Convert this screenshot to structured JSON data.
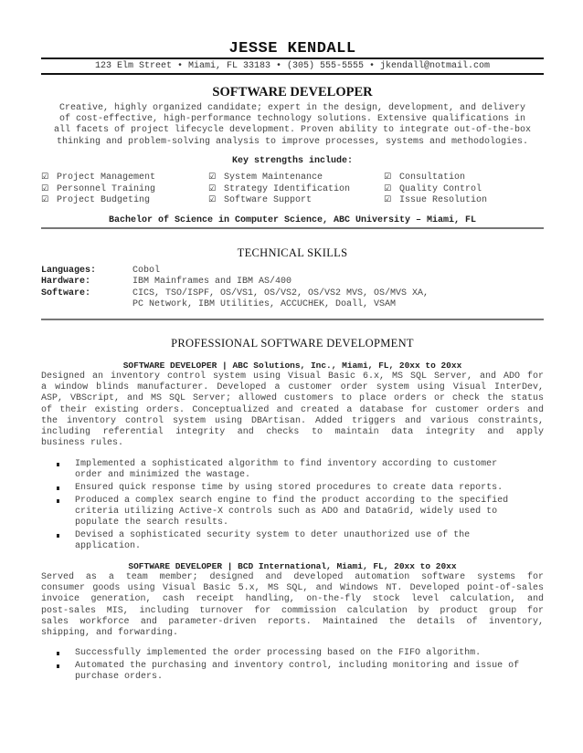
{
  "header": {
    "name": "JESSE KENDALL",
    "contact": "123 Elm Street • Miami, FL 33183 • (305) 555-5555 • jkendall@notmail.com"
  },
  "profile": {
    "title": "SOFTWARE DEVELOPER",
    "summary_lines": [
      "Creative, highly organized candidate; expert in the design, development, and delivery",
      "of cost-effective, high-performance technology solutions. Extensive qualifications in",
      "all facets of project lifecycle development. Proven ability to integrate out-of-the-box",
      "thinking and problem-solving analysis to improve processes, systems and methodologies."
    ]
  },
  "key_strengths": {
    "heading": "Key strengths include:",
    "checkbox_icon": "☑",
    "columns": [
      [
        "Project Management",
        "Personnel Training",
        "Project Budgeting"
      ],
      [
        "System Maintenance",
        "Strategy Identification",
        "Software Support"
      ],
      [
        "Consultation",
        "Quality Control",
        "Issue Resolution"
      ]
    ]
  },
  "education": "Bachelor of Science in Computer Science, ABC University – Miami, FL",
  "technical_skills": {
    "heading": "TECHNICAL SKILLS",
    "rows": [
      {
        "label": "Languages:",
        "lines": [
          "Cobol"
        ]
      },
      {
        "label": "Hardware:",
        "lines": [
          "IBM Mainframes and IBM AS/400"
        ]
      },
      {
        "label": "Software:",
        "lines": [
          "CICS, TSO/ISPF, OS/VS1, OS/VS2, OS/VS2 MVS, OS/MVS XA,",
          "PC Network, IBM Utilities, ACCUCHEK, Doall, VSAM"
        ]
      }
    ]
  },
  "experience": {
    "heading": "PROFESSIONAL SOFTWARE DEVELOPMENT",
    "jobs": [
      {
        "title": "SOFTWARE DEVELOPER | ABC Solutions, Inc., Miami, FL, 20xx to 20xx",
        "description_lines": [
          "Designed an inventory control system using Visual Basic 6.x, MS SQL Server, and ADO for",
          "a window blinds manufacturer. Developed a customer order system using Visual InterDev,",
          "ASP, VBScript, and MS SQL Server; allowed customers to place orders or check the status",
          "of their existing orders. Conceptualized and created a database for customer orders and",
          "the inventory control system using DBArtisan. Added triggers and various constraints,",
          "including referential integrity and checks to maintain data integrity and apply",
          "business rules."
        ],
        "bullets": [
          [
            "Implemented a sophisticated algorithm to find inventory according to customer",
            "order and minimized the wastage."
          ],
          [
            "Ensured quick response time by using stored procedures to create data reports."
          ],
          [
            "Produced a complex search engine to find the product according to the specified",
            "criteria utilizing Active-X controls such as ADO and DataGrid, widely used to",
            "populate the search results."
          ],
          [
            "Devised a sophisticated security system to deter unauthorized use of the",
            "application."
          ]
        ]
      },
      {
        "title": "SOFTWARE DEVELOPER | BCD International, Miami, FL, 20xx to 20xx",
        "description_lines": [
          "Served as a team member; designed and developed automation software systems for",
          "consumer goods using Visual Basic 5.x, MS SQL, and Windows NT. Developed point-of-sales",
          "invoice generation, cash receipt handling, on-the-fly stock level calculation, and",
          "post-sales MIS, including turnover for commission calculation by product group for",
          "sales workforce and parameter-driven reports. Maintained the details of inventory,",
          "shipping, and forwarding."
        ],
        "bullets": [
          [
            "Successfully implemented the order processing based on the FIFO algorithm."
          ],
          [
            "Automated the purchasing and inventory control, including monitoring and issue of",
            "purchase orders."
          ]
        ]
      }
    ]
  }
}
